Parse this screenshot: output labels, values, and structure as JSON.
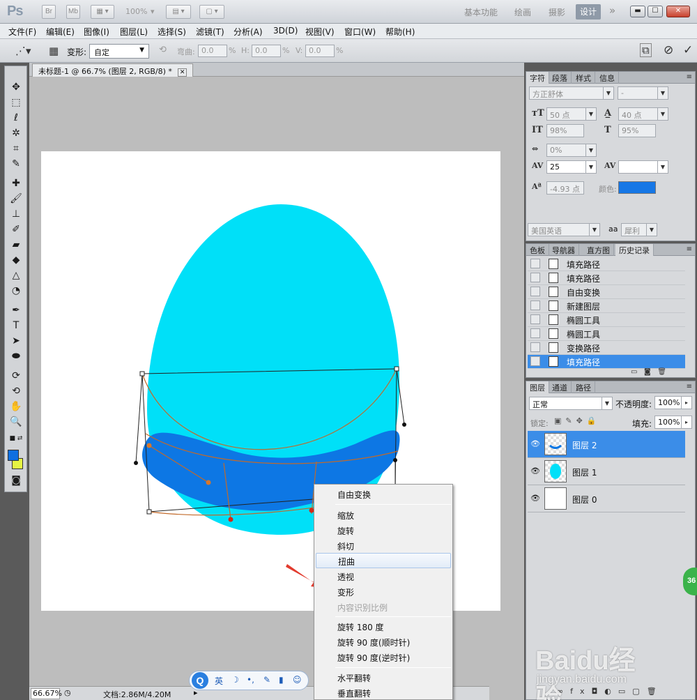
{
  "app": {
    "logo": "Ps",
    "bridge_btn": "Br",
    "minibridge_btn": "Mb",
    "zoom": "100%",
    "workspaces": [
      "基本功能",
      "绘画",
      "摄影",
      "设计"
    ],
    "active_workspace": "设计",
    "more": "»",
    "win_min": "▬",
    "win_max": "☐",
    "win_close": "✕"
  },
  "menu": [
    "文件(F)",
    "编辑(E)",
    "图像(I)",
    "图层(L)",
    "选择(S)",
    "滤镜(T)",
    "分析(A)",
    "3D(D)",
    "视图(V)",
    "窗口(W)",
    "帮助(H)"
  ],
  "options": {
    "warp_label": "变形:",
    "warp_value": "自定",
    "bend_label": "弯曲:",
    "bend_value": "0.0",
    "pct": "%",
    "h_label": "H:",
    "h_value": "0.0",
    "v_label": "V:",
    "v_value": "0.0"
  },
  "document": {
    "tab_title": "未标题-1 @ 66.7% (图层 2, RGB/8) *",
    "zoom_status": "66.67%",
    "doc_info": "文档:2.86M/4.20M"
  },
  "colors": {
    "egg": "#00e0f8",
    "band": "#0d77e4",
    "foreground": "#0f6fe0",
    "background": "#e6f542",
    "selection": "#3b8de8",
    "text_color_swatch": "#1677e6"
  },
  "context_menu": {
    "items": [
      {
        "label": "自由变换",
        "state": "normal"
      },
      {
        "label": "缩放",
        "state": "normal"
      },
      {
        "label": "旋转",
        "state": "normal"
      },
      {
        "label": "斜切",
        "state": "normal"
      },
      {
        "label": "扭曲",
        "state": "highlighted"
      },
      {
        "label": "透视",
        "state": "normal"
      },
      {
        "label": "变形",
        "state": "normal"
      },
      {
        "label": "内容识别比例",
        "state": "disabled"
      },
      {
        "label": "旋转 180 度",
        "state": "normal"
      },
      {
        "label": "旋转 90 度(顺时针)",
        "state": "normal"
      },
      {
        "label": "旋转 90 度(逆时针)",
        "state": "normal"
      },
      {
        "label": "水平翻转",
        "state": "normal"
      },
      {
        "label": "垂直翻转",
        "state": "normal"
      }
    ]
  },
  "character_panel": {
    "tabs": [
      "字符",
      "段落",
      "样式",
      "信息"
    ],
    "font_family": "方正舒体",
    "font_style": "-",
    "font_size": "50 点",
    "leading": "40 点",
    "vertical_scale": "98%",
    "horizontal_scale": "95%",
    "kerning_pct": "0%",
    "tracking": "25",
    "baseline": "-4.93 点",
    "color_label": "颜色:",
    "styles": [
      "T",
      "T",
      "TT",
      "Tr",
      "T¹",
      "T,",
      "T",
      "Ŧ"
    ],
    "language": "美国英语",
    "aa_label": "aa",
    "antialias": "犀利"
  },
  "history_panel": {
    "tabs": [
      "色板",
      "导航器",
      "直方图",
      "历史记录"
    ],
    "items": [
      "填充路径",
      "填充路径",
      "自由变换",
      "新建图层",
      "椭圆工具",
      "椭圆工具",
      "变换路径",
      "填充路径"
    ]
  },
  "layers_panel": {
    "tabs": [
      "图层",
      "通道",
      "路径"
    ],
    "blend_mode": "正常",
    "opacity_label": "不透明度:",
    "opacity": "100%",
    "lock_label": "锁定:",
    "fill_label": "填充:",
    "fill": "100%",
    "layers": [
      "图层 2",
      "图层 1",
      "图层 0"
    ]
  },
  "watermark": {
    "text": "Baidu经验",
    "url": "jingyan.baidu.com"
  },
  "side_badge": "36",
  "ime": {
    "logo": "Q",
    "glyphs": [
      "英",
      "☽",
      "•,",
      "✎",
      "▮",
      "☺"
    ]
  }
}
